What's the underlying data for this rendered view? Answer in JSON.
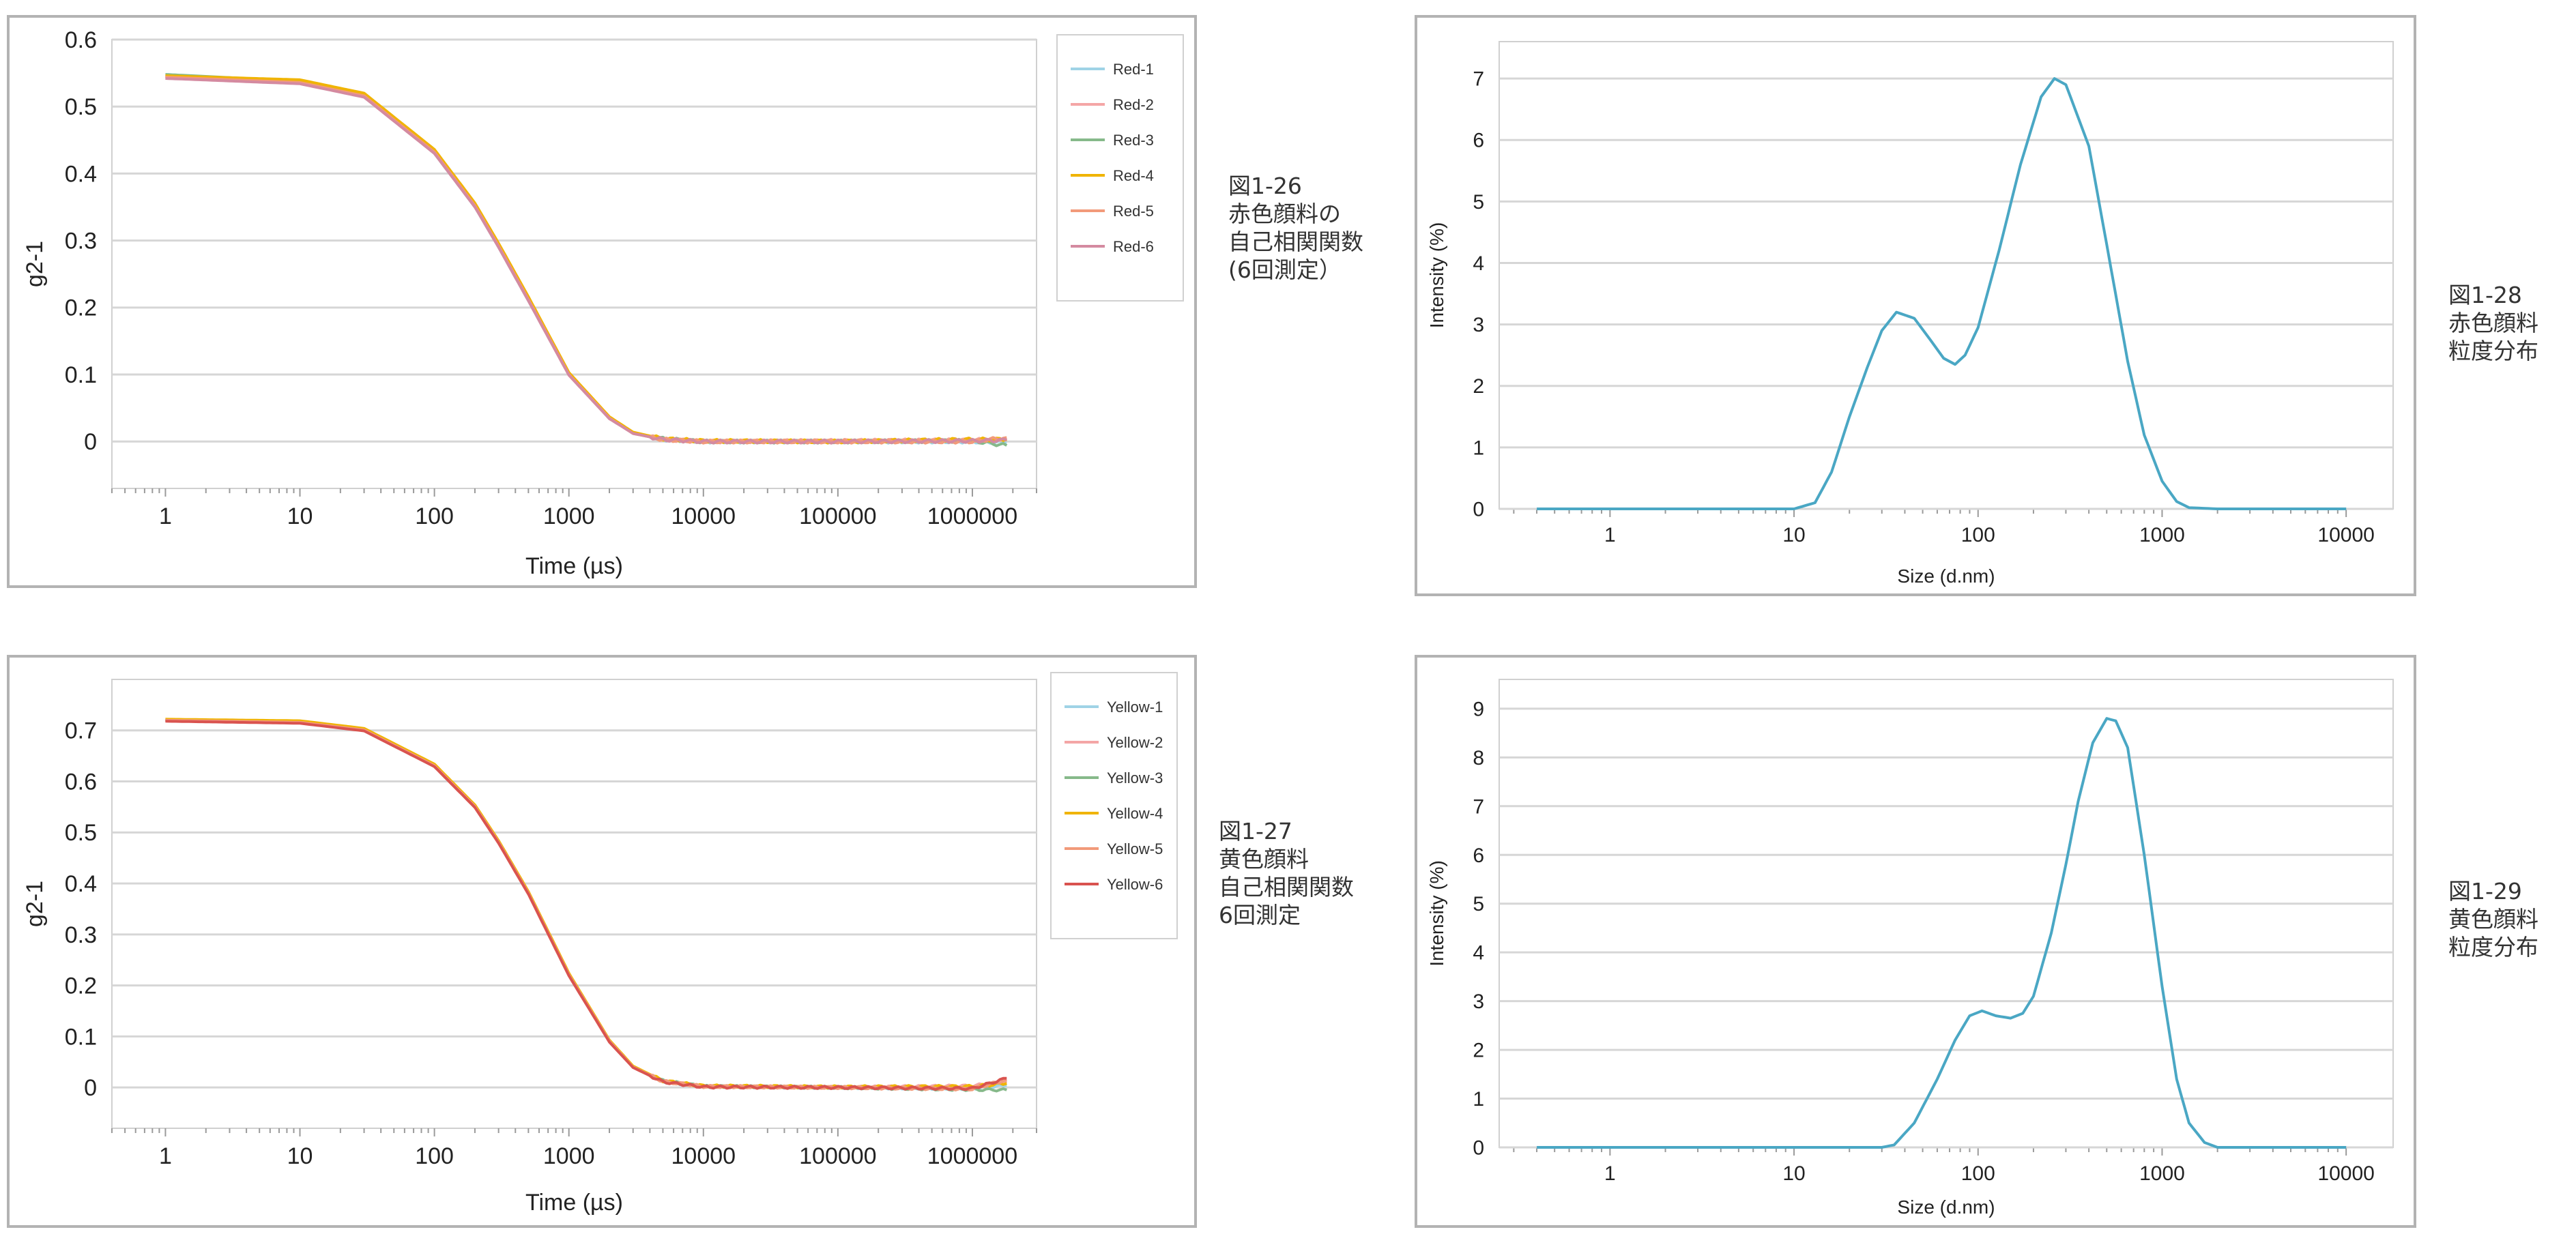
{
  "charts": [
    {
      "id": "acf-red",
      "caption": [
        "図1-26",
        "赤色顔料の",
        "自己相関関数",
        "(6回測定）"
      ],
      "chart_data": {
        "type": "line",
        "xlabel": "Time (µs)",
        "ylabel": "g2-1",
        "xscale": "log",
        "xlim": [
          0.4,
          3000000
        ],
        "ylim": [
          -0.07,
          0.6
        ],
        "x_ticks": [
          1,
          10,
          100,
          1000,
          10000,
          100000,
          1000000
        ],
        "x_tick_labels": [
          "1",
          "10",
          "100",
          "1000",
          "10000",
          "100000",
          "1000000"
        ],
        "y_ticks": [
          0,
          0.1,
          0.2,
          0.3,
          0.4,
          0.5,
          0.6
        ],
        "y_tick_labels": [
          "0",
          "0.1",
          "0.2",
          "0.3",
          "0.4",
          "0.5",
          "0.6"
        ],
        "grid": true,
        "legend": "top-right",
        "x": [
          1,
          10,
          30,
          100,
          200,
          300,
          500,
          1000,
          2000,
          3000,
          5000,
          10000,
          100000,
          1000000,
          1800000
        ],
        "series": [
          {
            "name": "Red-1",
            "color": "#9fd3e6",
            "values": [
              0.545,
              0.535,
              0.515,
              0.43,
              0.35,
              0.29,
              0.21,
              0.1,
              0.035,
              0.012,
              0.003,
              0,
              0,
              0,
              -0.002
            ]
          },
          {
            "name": "Red-2",
            "color": "#f4a6a6",
            "values": [
              0.545,
              0.536,
              0.516,
              0.432,
              0.352,
              0.292,
              0.212,
              0.101,
              0.036,
              0.013,
              0.003,
              0,
              0.001,
              0.002,
              0.004
            ]
          },
          {
            "name": "Red-3",
            "color": "#86b98a",
            "values": [
              0.548,
              0.538,
              0.518,
              0.434,
              0.354,
              0.294,
              0.214,
              0.102,
              0.036,
              0.013,
              0.004,
              0,
              0,
              0.001,
              -0.006
            ]
          },
          {
            "name": "Red-4",
            "color": "#f0b400",
            "values": [
              0.546,
              0.54,
              0.52,
              0.436,
              0.356,
              0.296,
              0.216,
              0.103,
              0.037,
              0.014,
              0.004,
              0.001,
              0,
              0.003,
              0.003
            ]
          },
          {
            "name": "Red-5",
            "color": "#f29a7a",
            "values": [
              0.544,
              0.536,
              0.516,
              0.432,
              0.352,
              0.292,
              0.212,
              0.1,
              0.035,
              0.012,
              0.003,
              0,
              0,
              0,
              0.006
            ]
          },
          {
            "name": "Red-6",
            "color": "#d48aa0",
            "values": [
              0.542,
              0.534,
              0.514,
              0.43,
              0.35,
              0.29,
              0.21,
              0.099,
              0.034,
              0.012,
              0.003,
              0,
              0,
              0.001,
              0.002
            ]
          }
        ]
      }
    },
    {
      "id": "acf-yellow",
      "caption": [
        "図1-27",
        "黄色顔料",
        "自己相関関数",
        "6回測定"
      ],
      "chart_data": {
        "type": "line",
        "xlabel": "Time (µs)",
        "ylabel": "g2-1",
        "xscale": "log",
        "xlim": [
          0.4,
          3000000
        ],
        "ylim": [
          -0.08,
          0.8
        ],
        "x_ticks": [
          1,
          10,
          100,
          1000,
          10000,
          100000,
          1000000
        ],
        "x_tick_labels": [
          "1",
          "10",
          "100",
          "1000",
          "10000",
          "100000",
          "1000000"
        ],
        "y_ticks": [
          0,
          0.1,
          0.2,
          0.3,
          0.4,
          0.5,
          0.6,
          0.7
        ],
        "y_tick_labels": [
          "0",
          "0.1",
          "0.2",
          "0.3",
          "0.4",
          "0.5",
          "0.6",
          "0.7"
        ],
        "grid": true,
        "legend": "top-right",
        "x": [
          1,
          10,
          30,
          100,
          200,
          300,
          500,
          1000,
          2000,
          3000,
          5000,
          10000,
          100000,
          1000000,
          1800000
        ],
        "series": [
          {
            "name": "Yellow-1",
            "color": "#9fd3e6",
            "values": [
              0.72,
              0.715,
              0.7,
              0.63,
              0.55,
              0.48,
              0.38,
              0.22,
              0.09,
              0.04,
              0.012,
              0.002,
              0,
              -0.002,
              0.004
            ]
          },
          {
            "name": "Yellow-2",
            "color": "#f4a6a6",
            "values": [
              0.72,
              0.716,
              0.701,
              0.631,
              0.551,
              0.481,
              0.381,
              0.221,
              0.091,
              0.041,
              0.012,
              0.002,
              0,
              0.003,
              0.012
            ]
          },
          {
            "name": "Yellow-3",
            "color": "#86b98a",
            "values": [
              0.72,
              0.717,
              0.702,
              0.632,
              0.552,
              0.482,
              0.382,
              0.222,
              0.092,
              0.041,
              0.013,
              0.002,
              0,
              -0.004,
              -0.005
            ]
          },
          {
            "name": "Yellow-4",
            "color": "#f0b400",
            "values": [
              0.722,
              0.719,
              0.704,
              0.634,
              0.554,
              0.484,
              0.384,
              0.224,
              0.093,
              0.042,
              0.013,
              0.003,
              0.001,
              0.002,
              0.008
            ]
          },
          {
            "name": "Yellow-5",
            "color": "#f29a7a",
            "values": [
              0.72,
              0.716,
              0.701,
              0.631,
              0.551,
              0.481,
              0.381,
              0.221,
              0.091,
              0.04,
              0.012,
              0.002,
              0,
              -0.003,
              0.015
            ]
          },
          {
            "name": "Yellow-6",
            "color": "#d9534f",
            "values": [
              0.718,
              0.714,
              0.699,
              0.629,
              0.549,
              0.479,
              0.379,
              0.219,
              0.089,
              0.039,
              0.011,
              0.001,
              0,
              -0.002,
              0.018
            ]
          }
        ]
      }
    },
    {
      "id": "psd-red",
      "caption": [
        "図1-28",
        "赤色顔料",
        "粒度分布"
      ],
      "chart_data": {
        "type": "line",
        "xlabel": "Size (d.nm)",
        "ylabel": "Intensity (%)",
        "xscale": "log",
        "xlim": [
          0.25,
          18000
        ],
        "ylim": [
          0,
          7.6
        ],
        "x_ticks": [
          1,
          10,
          100,
          1000,
          10000
        ],
        "x_tick_labels": [
          "1",
          "10",
          "100",
          "1000",
          "10000"
        ],
        "y_ticks": [
          0,
          1,
          2,
          3,
          4,
          5,
          6,
          7
        ],
        "y_tick_labels": [
          "0",
          "1",
          "2",
          "3",
          "4",
          "5",
          "6",
          "7"
        ],
        "grid": true,
        "legend": "none",
        "x": [
          0.4,
          1,
          3,
          10,
          13,
          16,
          20,
          25,
          30,
          36,
          45,
          55,
          65,
          75,
          85,
          100,
          130,
          170,
          220,
          260,
          300,
          400,
          500,
          650,
          800,
          1000,
          1200,
          1400,
          2000,
          5000,
          10000
        ],
        "series": [
          {
            "name": "",
            "color": "#4aa7c4",
            "values": [
              0,
              0,
              0,
              0,
              0.1,
              0.6,
              1.5,
              2.3,
              2.9,
              3.2,
              3.1,
              2.75,
              2.45,
              2.35,
              2.5,
              2.95,
              4.2,
              5.6,
              6.7,
              7.0,
              6.9,
              5.9,
              4.3,
              2.4,
              1.2,
              0.45,
              0.12,
              0.02,
              0,
              0,
              0
            ]
          }
        ]
      }
    },
    {
      "id": "psd-yellow",
      "caption": [
        "図1-29",
        "黄色顔料",
        "粒度分布"
      ],
      "chart_data": {
        "type": "line",
        "xlabel": "Size (d.nm)",
        "ylabel": "Intensity (%)",
        "xscale": "log",
        "xlim": [
          0.25,
          18000
        ],
        "ylim": [
          0,
          9.6
        ],
        "x_ticks": [
          1,
          10,
          100,
          1000,
          10000
        ],
        "x_tick_labels": [
          "1",
          "10",
          "100",
          "1000",
          "10000"
        ],
        "y_ticks": [
          0,
          1,
          2,
          3,
          4,
          5,
          6,
          7,
          8,
          9
        ],
        "y_tick_labels": [
          "0",
          "1",
          "2",
          "3",
          "4",
          "5",
          "6",
          "7",
          "8",
          "9"
        ],
        "grid": true,
        "legend": "none",
        "x": [
          0.4,
          1,
          10,
          30,
          35,
          45,
          60,
          75,
          90,
          105,
          125,
          150,
          175,
          200,
          250,
          300,
          350,
          420,
          500,
          560,
          650,
          800,
          1000,
          1200,
          1400,
          1700,
          2000,
          5000,
          10000
        ],
        "series": [
          {
            "name": "",
            "color": "#4aa7c4",
            "values": [
              0,
              0,
              0,
              0,
              0.05,
              0.5,
              1.4,
              2.2,
              2.7,
              2.8,
              2.7,
              2.65,
              2.75,
              3.1,
              4.4,
              5.8,
              7.1,
              8.3,
              8.8,
              8.75,
              8.2,
              6.0,
              3.3,
              1.4,
              0.5,
              0.1,
              0,
              0,
              0
            ]
          }
        ]
      }
    }
  ]
}
